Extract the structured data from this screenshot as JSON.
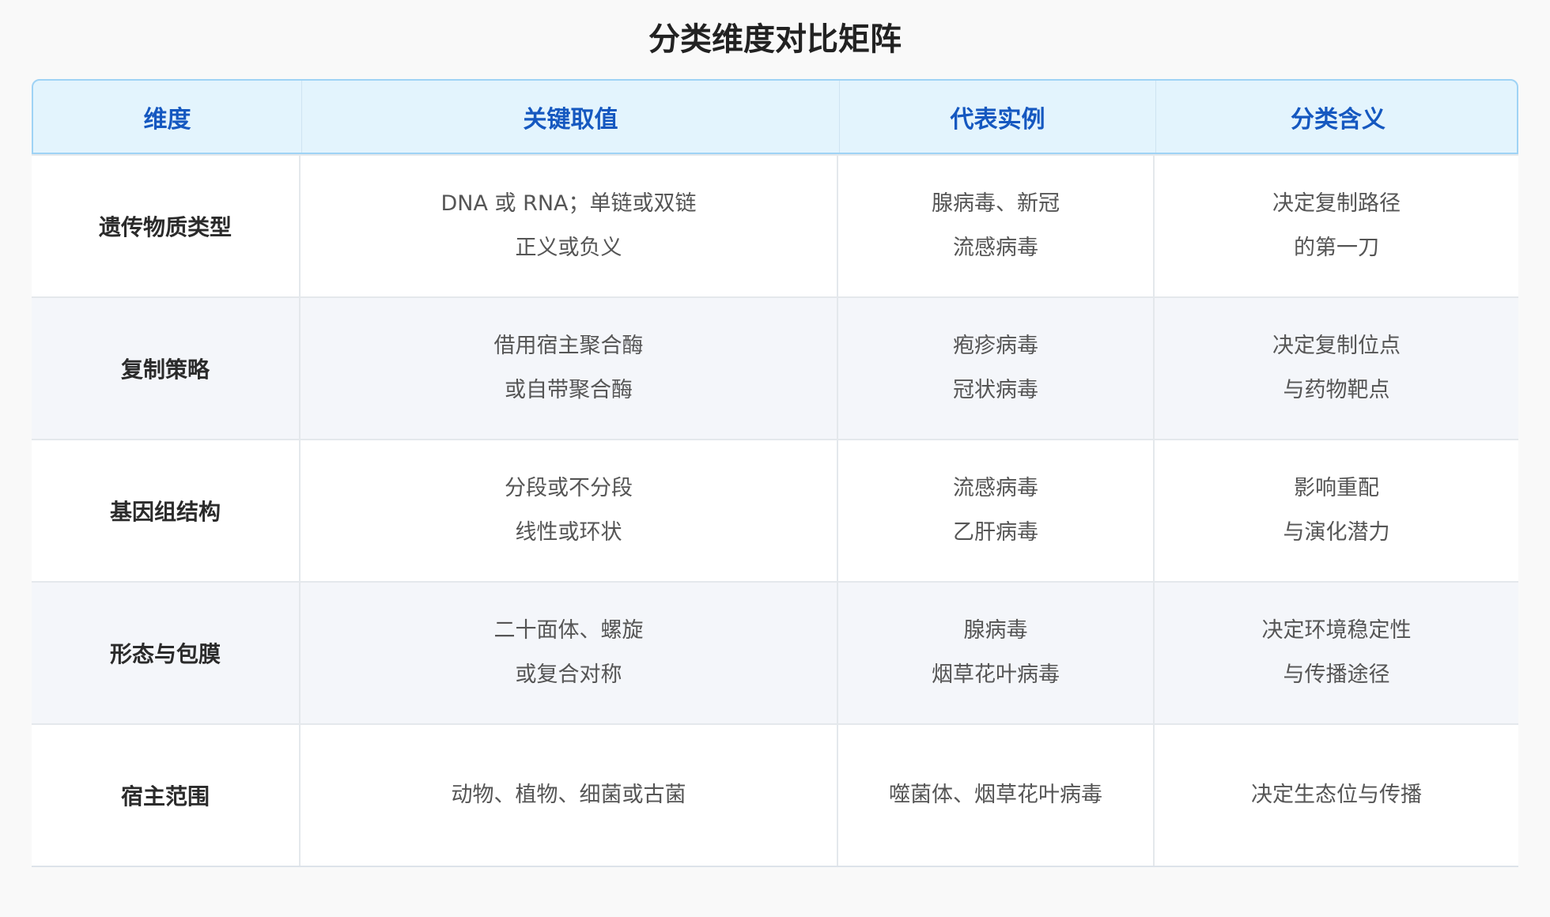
{
  "title": "分类维度对比矩阵",
  "headers": [
    "维度",
    "关键取值",
    "代表实例",
    "分类含义"
  ],
  "rows": [
    {
      "dimension": "遗传物质类型",
      "values": [
        "DNA 或 RNA；单链或双链",
        "正义或负义"
      ],
      "examples": [
        "腺病毒、新冠",
        "流感病毒"
      ],
      "meaning": [
        "决定复制路径",
        "的第一刀"
      ]
    },
    {
      "dimension": "复制策略",
      "values": [
        "借用宿主聚合酶",
        "或自带聚合酶"
      ],
      "examples": [
        "疱疹病毒",
        "冠状病毒"
      ],
      "meaning": [
        "决定复制位点",
        "与药物靶点"
      ]
    },
    {
      "dimension": "基因组结构",
      "values": [
        "分段或不分段",
        "线性或环状"
      ],
      "examples": [
        "流感病毒",
        "乙肝病毒"
      ],
      "meaning": [
        "影响重配",
        "与演化潜力"
      ]
    },
    {
      "dimension": "形态与包膜",
      "values": [
        "二十面体、螺旋",
        "或复合对称"
      ],
      "examples": [
        "腺病毒",
        "烟草花叶病毒"
      ],
      "meaning": [
        "决定环境稳定性",
        "与传播途径"
      ]
    },
    {
      "dimension": "宿主范围",
      "values": [
        "动物、植物、细菌或古菌"
      ],
      "examples": [
        "噬菌体、烟草花叶病毒"
      ],
      "meaning": [
        "决定生态位与传播"
      ]
    }
  ]
}
